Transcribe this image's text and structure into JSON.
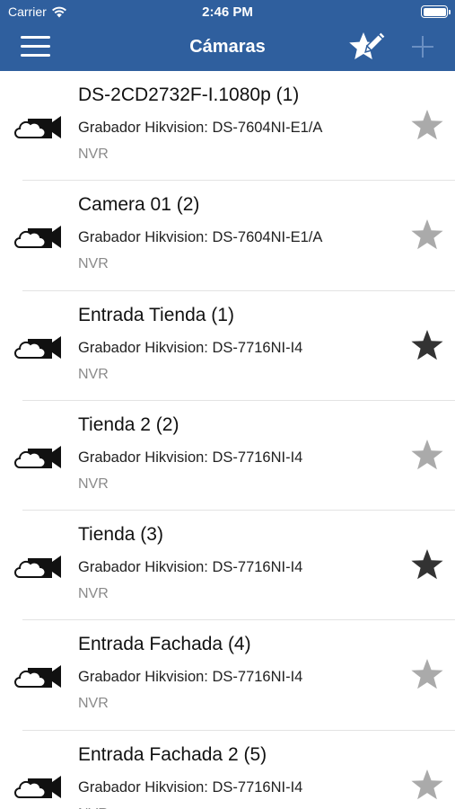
{
  "status_bar": {
    "carrier": "Carrier",
    "time": "2:46 PM",
    "wifi_icon": "wifi-icon",
    "battery_icon": "battery-icon"
  },
  "nav": {
    "title": "Cámaras",
    "menu_icon": "hamburger-menu-icon",
    "edit_favorites_icon": "star-pencil-icon",
    "add_icon": "plus-icon",
    "add_enabled": false
  },
  "colors": {
    "nav_background": "#2f5f9e",
    "star_on": "#333333",
    "star_off": "#aaaaaa",
    "text_secondary": "#8a8a8a"
  },
  "cameras": [
    {
      "name": "DS-2CD2732F-I.1080p (1)",
      "device": "Grabador Hikvision: DS-7604NI-E1/A",
      "type": "NVR",
      "favorite": false
    },
    {
      "name": "Camera 01 (2)",
      "device": "Grabador Hikvision: DS-7604NI-E1/A",
      "type": "NVR",
      "favorite": false
    },
    {
      "name": "Entrada Tienda (1)",
      "device": "Grabador Hikvision: DS-7716NI-I4",
      "type": "NVR",
      "favorite": true
    },
    {
      "name": "Tienda 2 (2)",
      "device": "Grabador Hikvision: DS-7716NI-I4",
      "type": "NVR",
      "favorite": false
    },
    {
      "name": "Tienda (3)",
      "device": "Grabador Hikvision: DS-7716NI-I4",
      "type": "NVR",
      "favorite": true
    },
    {
      "name": "Entrada Fachada (4)",
      "device": "Grabador Hikvision: DS-7716NI-I4",
      "type": "NVR",
      "favorite": false
    },
    {
      "name": "Entrada Fachada 2 (5)",
      "device": "Grabador Hikvision: DS-7716NI-I4",
      "type": "NVR",
      "favorite": false
    }
  ]
}
